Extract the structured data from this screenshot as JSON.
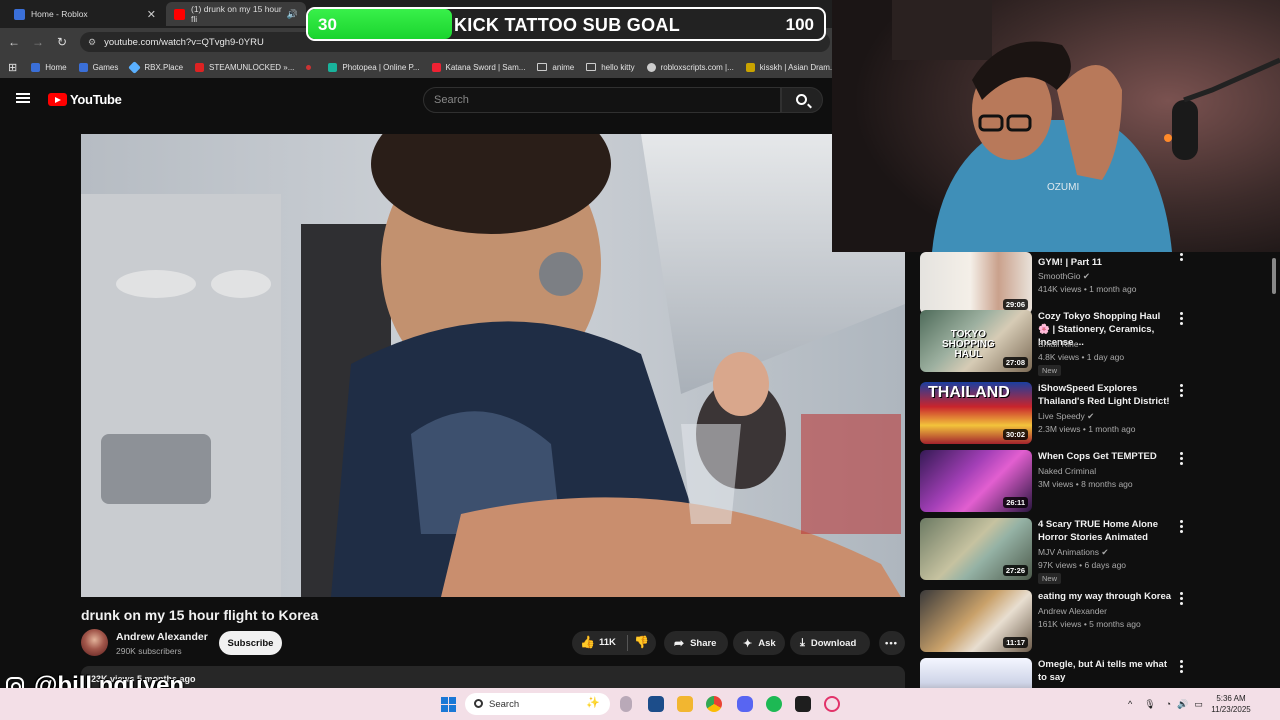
{
  "browser": {
    "tabs": [
      {
        "title": "Home - Roblox"
      },
      {
        "title": "(1) drunk on my 15 hour fli"
      }
    ],
    "url": "youtube.com/watch?v=QTvgh9-0YRU",
    "bookmarks": [
      "Home",
      "Games",
      "RBX.Place",
      "STEAMUNLOCKED »...",
      "Photopea | Online P...",
      "Katana Sword | Sam...",
      "anime",
      "hello kitty",
      "robloxscripts.com |...",
      "kisskh | Asian Dram..."
    ]
  },
  "goal_overlay": {
    "start": "30",
    "title": "KICK TATTOO SUB GOAL",
    "end": "100",
    "progress": 0.28
  },
  "youtube": {
    "logo": "YouTube",
    "search_placeholder": "Search",
    "video": {
      "title": "drunk on my 15 hour flight to Korea",
      "channel": "Andrew Alexander",
      "subscribers": "290K subscribers",
      "subscribe_label": "Subscribe",
      "likes": "11K",
      "share_label": "Share",
      "ask_label": "Ask",
      "download_label": "Download",
      "meta": "23K views  5 months ago"
    },
    "recommendations": [
      {
        "title": "GYM! | Part 11",
        "channel": "SmoothGio",
        "views": "414K views • 1 month ago",
        "duration": "29:06",
        "new": ""
      },
      {
        "title": "Cozy Tokyo Shopping Haul 🌸 | Stationery, Ceramics, Incense ...",
        "channel": "Small Kine",
        "views": "4.8K views • 1 day ago",
        "duration": "27:08",
        "new": "New"
      },
      {
        "title": "iShowSpeed Explores Thailand's Red Light District!",
        "channel": "Live Speedy",
        "views": "2.3M views • 1 month ago",
        "duration": "30:02",
        "new": ""
      },
      {
        "title": "When Cops Get TEMPTED",
        "channel": "Naked Criminal",
        "views": "3M views • 8 months ago",
        "duration": "26:11",
        "new": ""
      },
      {
        "title": "4 Scary TRUE Home Alone Horror Stories Animated",
        "channel": "MJV Animations",
        "views": "97K views • 6 days ago",
        "duration": "27:26",
        "new": "New"
      },
      {
        "title": "eating my way through Korea",
        "channel": "Andrew Alexander",
        "views": "161K views • 5 months ago",
        "duration": "11:17",
        "new": ""
      },
      {
        "title": "Omegle, but Ai tells me what to say",
        "channel": "",
        "views": "",
        "duration": "",
        "new": ""
      }
    ]
  },
  "watermark": {
    "handle": "@bill.nguyen"
  },
  "taskbar": {
    "search_placeholder": "Search",
    "time": "5:36 AM",
    "date": "11/23/2025"
  }
}
